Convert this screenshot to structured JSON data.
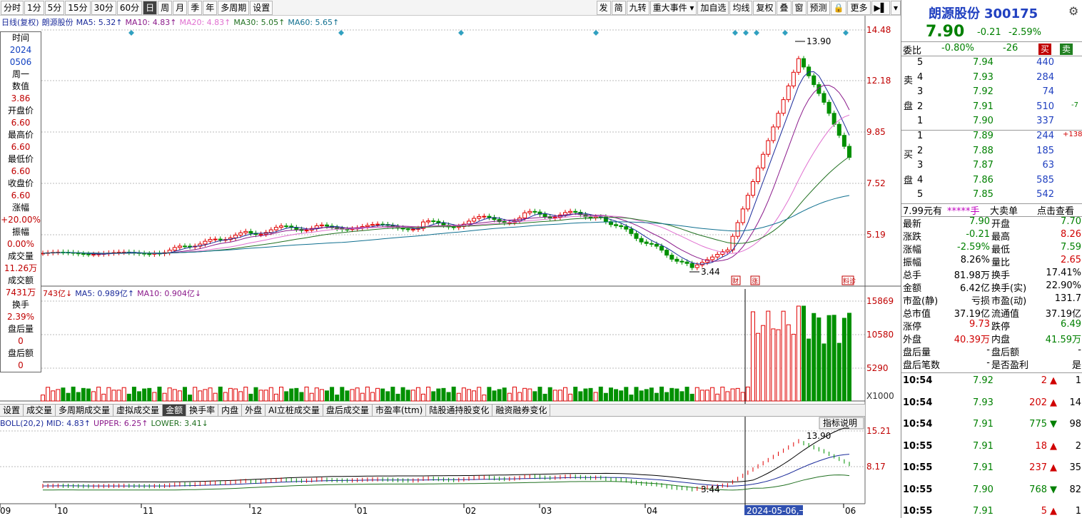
{
  "toolbar": {
    "left": [
      "分时",
      "1分",
      "5分",
      "15分",
      "30分",
      "60分",
      "日",
      "周",
      "月",
      "季",
      "年",
      "多周期",
      "设置"
    ],
    "active_index": 6,
    "right": [
      "发",
      "简",
      "九转",
      "重大事件 ▾",
      "加自选",
      "均线",
      "复权",
      "叠",
      "窗",
      "预测",
      "🔒",
      "更多",
      "▶▌",
      "▾"
    ]
  },
  "ma_legend": {
    "prefix": "日线(复权)",
    "name": "朗源股份",
    "items": [
      {
        "text": "MA5: 5.32↑",
        "color": "#1a2a9a"
      },
      {
        "text": "MA10: 4.83↑",
        "color": "#8b1a8b"
      },
      {
        "text": "MA20: 4.83↑",
        "color": "#e070d0"
      },
      {
        "text": "MA30: 5.05↑",
        "color": "#207020"
      },
      {
        "text": "MA60: 5.65↑",
        "color": "#107090"
      }
    ]
  },
  "price_axis": [
    "14.48",
    "12.18",
    "9.85",
    "7.52",
    "5.19"
  ],
  "vol_legend": {
    "items": [
      {
        "text": "743亿↓",
        "color": "#c00000"
      },
      {
        "text": "MA5: 0.989亿↑",
        "color": "#1a2a9a"
      },
      {
        "text": "MA10: 0.904亿↓",
        "color": "#8b1a8b"
      }
    ]
  },
  "vol_axis": [
    "15869",
    "10580",
    "5290",
    "X1000"
  ],
  "boll_legend": {
    "items": [
      {
        "text": "BOLL(20,2) MID: 4.83↑",
        "color": "#1a2a9a"
      },
      {
        "text": "UPPER: 6.25↑",
        "color": "#8b1a8b"
      },
      {
        "text": "LOWER: 3.41↓",
        "color": "#207020"
      }
    ],
    "help": "指标说明"
  },
  "boll_axis": [
    "15.21",
    "8.17"
  ],
  "date_axis": [
    "09",
    "10",
    "11",
    "12",
    "01",
    "02",
    "03",
    "04",
    "2024-05-06,一",
    "06"
  ],
  "annotations": {
    "high": "13.90",
    "low": "3.44",
    "boll_high": "13.90",
    "boll_low": "3.44",
    "event1": "财",
    "event2": "涨",
    "event3": "料诊"
  },
  "indicator_tabs": [
    "设置",
    "成交量",
    "多周期成交量",
    "虚拟成交量",
    "金额",
    "换手率",
    "内盘",
    "外盘",
    "AI立桩成交量",
    "盘后成交量",
    "市盈率(ttm)",
    "陆股通持股变化",
    "融资融券变化"
  ],
  "indicator_active": 4,
  "info": [
    {
      "label": "时间",
      "value": "2024"
    },
    {
      "label": "",
      "value": "0506"
    },
    {
      "label": "周一",
      "value": ""
    },
    {
      "label": "数值",
      "value": "3.86"
    },
    {
      "label": "开盘价",
      "value": "6.60"
    },
    {
      "label": "最高价",
      "value": "6.60"
    },
    {
      "label": "最低价",
      "value": "6.60"
    },
    {
      "label": "收盘价",
      "value": "6.60"
    },
    {
      "label": "涨幅",
      "value": "+20.00%"
    },
    {
      "label": "振幅",
      "value": "0.00%"
    },
    {
      "label": "成交量",
      "value": "11.26万"
    },
    {
      "label": "成交额",
      "value": "7431万"
    },
    {
      "label": "换手",
      "value": "2.39%"
    },
    {
      "label": "盘后量",
      "value": "0"
    },
    {
      "label": "盘后额",
      "value": "0"
    }
  ],
  "quote": {
    "name": "朗源股份",
    "code": "300175",
    "price": "7.90",
    "change": "-0.21",
    "pct": "-2.59%",
    "weibi_label": "委比",
    "weibi": "-0.80%",
    "weicha": "-26",
    "buy_btn": "买",
    "sell_btn": "卖",
    "sell_label": [
      "卖",
      "盘"
    ],
    "buy_label": [
      "买",
      "盘"
    ],
    "sells": [
      {
        "n": "5",
        "p": "7.94",
        "v": "440",
        "d": ""
      },
      {
        "n": "4",
        "p": "7.93",
        "v": "284",
        "d": ""
      },
      {
        "n": "3",
        "p": "7.92",
        "v": "74",
        "d": ""
      },
      {
        "n": "2",
        "p": "7.91",
        "v": "510",
        "d": "-7"
      },
      {
        "n": "1",
        "p": "7.90",
        "v": "337",
        "d": ""
      }
    ],
    "buys": [
      {
        "n": "1",
        "p": "7.89",
        "v": "244",
        "d": "+138"
      },
      {
        "n": "2",
        "p": "7.88",
        "v": "185",
        "d": ""
      },
      {
        "n": "3",
        "p": "7.87",
        "v": "63",
        "d": ""
      },
      {
        "n": "4",
        "p": "7.86",
        "v": "585",
        "d": ""
      },
      {
        "n": "5",
        "p": "7.85",
        "v": "542",
        "d": ""
      }
    ],
    "bigorder": {
      "a": "7.99元有",
      "b": "*****手",
      "c": "大卖单",
      "d": "点击查看"
    },
    "stats": [
      {
        "l1": "最新",
        "v1": "7.90",
        "c1": "green",
        "l2": "开盘",
        "v2": "7.70",
        "c2": "green"
      },
      {
        "l1": "涨跌",
        "v1": "-0.21",
        "c1": "green",
        "l2": "最高",
        "v2": "8.26",
        "c2": "red"
      },
      {
        "l1": "涨幅",
        "v1": "-2.59%",
        "c1": "green",
        "l2": "最低",
        "v2": "7.59",
        "c2": "green"
      },
      {
        "l1": "振幅",
        "v1": "8.26%",
        "c1": "",
        "l2": "量比",
        "v2": "2.65",
        "c2": "red"
      },
      {
        "l1": "总手",
        "v1": "81.98万",
        "c1": "",
        "l2": "换手",
        "v2": "17.41%",
        "c2": ""
      },
      {
        "l1": "金额",
        "v1": "6.42亿",
        "c1": "",
        "l2": "换手(实)",
        "v2": "22.90%",
        "c2": ""
      },
      {
        "l1": "市盈(静)",
        "v1": "亏损",
        "c1": "",
        "l2": "市盈(动)",
        "v2": "131.7",
        "c2": ""
      },
      {
        "l1": "总市值",
        "v1": "37.19亿",
        "c1": "",
        "l2": "流通值",
        "v2": "37.19亿",
        "c2": ""
      },
      {
        "l1": "涨停",
        "v1": "9.73",
        "c1": "red",
        "l2": "跌停",
        "v2": "6.49",
        "c2": "green"
      },
      {
        "l1": "外盘",
        "v1": "40.39万",
        "c1": "red",
        "l2": "内盘",
        "v2": "41.59万",
        "c2": "green"
      },
      {
        "l1": "盘后量",
        "v1": "-",
        "c1": "",
        "l2": "盘后额",
        "v2": "-",
        "c2": ""
      },
      {
        "l1": "盘后笔数",
        "v1": "-",
        "c1": "",
        "l2": "是否盈利",
        "v2": "是",
        "c2": ""
      }
    ],
    "ticks": [
      {
        "t": "10:54",
        "p": "7.92",
        "v": "2",
        "dir": "up",
        "n": "1",
        "c": "green"
      },
      {
        "t": "10:54",
        "p": "7.93",
        "v": "202",
        "dir": "up",
        "n": "14",
        "c": "green"
      },
      {
        "t": "10:54",
        "p": "7.91",
        "v": "775",
        "dir": "down",
        "n": "98",
        "c": "green"
      },
      {
        "t": "10:55",
        "p": "7.91",
        "v": "18",
        "dir": "up",
        "n": "2",
        "c": "green"
      },
      {
        "t": "10:55",
        "p": "7.91",
        "v": "237",
        "dir": "up",
        "n": "35",
        "c": "green"
      },
      {
        "t": "10:55",
        "p": "7.90",
        "v": "768",
        "dir": "down",
        "n": "82",
        "c": "green"
      },
      {
        "t": "10:55",
        "p": "7.91",
        "v": "5",
        "dir": "up",
        "n": "1",
        "c": "green"
      }
    ]
  }
}
